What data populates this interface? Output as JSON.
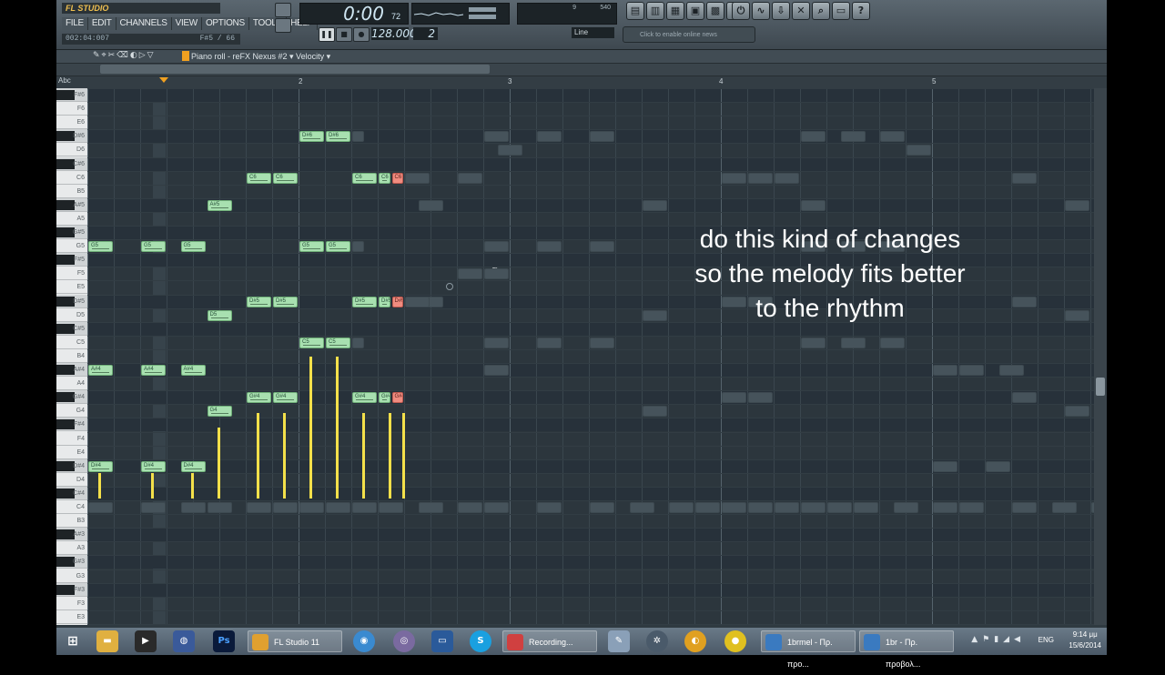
{
  "app": {
    "name": "FL STUDIO"
  },
  "menu": [
    "FILE",
    "EDIT",
    "CHANNELS",
    "VIEW",
    "OPTIONS",
    "TOOLS",
    "HELP"
  ],
  "position_readout": {
    "left": "002:04:007",
    "right": "F#5 / 66"
  },
  "song_time": {
    "main": "0:00",
    "sub": "72"
  },
  "tempo": "128.000",
  "pattern": "2",
  "cpu_readout": {
    "poly": "9",
    "mem": "540"
  },
  "snap": "Line",
  "news": "Click to enable online news",
  "piano_roll": {
    "title": "Piano roll - reFX Nexus #2 ▾  Velocity ▾",
    "abc": "Abc",
    "bars": [
      "2",
      "3",
      "4",
      "5"
    ]
  },
  "keys": [
    "F#6",
    "F6",
    "E6",
    "D#6",
    "D6",
    "C#6",
    "C6",
    "B5",
    "A#5",
    "A5",
    "G#5",
    "G5",
    "F#5",
    "F5",
    "E5",
    "D#5",
    "D5",
    "C#5",
    "C5",
    "B4",
    "A#4",
    "A4",
    "G#4",
    "G4",
    "F#4",
    "F4",
    "E4",
    "D#4",
    "D4",
    "C#4",
    "C4",
    "B3",
    "A#3",
    "A3",
    "G#3",
    "G3",
    "F#3",
    "F3",
    "E3"
  ],
  "notes": [
    {
      "key": "G5",
      "start": 0,
      "len": 1,
      "label": "G5",
      "style": "green"
    },
    {
      "key": "A#4",
      "start": 0,
      "len": 1,
      "label": "A#4",
      "style": "green"
    },
    {
      "key": "D#4",
      "start": 0,
      "len": 1,
      "label": "D#4",
      "style": "green"
    },
    {
      "key": "G5",
      "start": 2,
      "len": 1,
      "label": "G5",
      "style": "green"
    },
    {
      "key": "A#4",
      "start": 2,
      "len": 1,
      "label": "A#4",
      "style": "green"
    },
    {
      "key": "D#4",
      "start": 2,
      "len": 1,
      "label": "D#4",
      "style": "green"
    },
    {
      "key": "G5",
      "start": 3.5,
      "len": 1,
      "label": "G5",
      "style": "green"
    },
    {
      "key": "A#4",
      "start": 3.5,
      "len": 1,
      "label": "A#4",
      "style": "green"
    },
    {
      "key": "D#4",
      "start": 3.5,
      "len": 1,
      "label": "D#4",
      "style": "green"
    },
    {
      "key": "A#5",
      "start": 4.5,
      "len": 1,
      "label": "A#5",
      "style": "green"
    },
    {
      "key": "D5",
      "start": 4.5,
      "len": 1,
      "label": "D5",
      "style": "green"
    },
    {
      "key": "G4",
      "start": 4.5,
      "len": 1,
      "label": "G4",
      "style": "green"
    },
    {
      "key": "C6",
      "start": 6,
      "len": 1,
      "label": "C6",
      "style": "green"
    },
    {
      "key": "D#5",
      "start": 6,
      "len": 1,
      "label": "D#5",
      "style": "green"
    },
    {
      "key": "G#4",
      "start": 6,
      "len": 1,
      "label": "G#4",
      "style": "green"
    },
    {
      "key": "C6",
      "start": 7,
      "len": 1,
      "label": "C6",
      "style": "green"
    },
    {
      "key": "D#5",
      "start": 7,
      "len": 1,
      "label": "D#5",
      "style": "green"
    },
    {
      "key": "G#4",
      "start": 7,
      "len": 1,
      "label": "G#4",
      "style": "green"
    },
    {
      "key": "D#6",
      "start": 8,
      "len": 1,
      "label": "D#6",
      "style": "green"
    },
    {
      "key": "G5",
      "start": 8,
      "len": 1,
      "label": "G5",
      "style": "green"
    },
    {
      "key": "C5",
      "start": 8,
      "len": 1,
      "label": "C5",
      "style": "green"
    },
    {
      "key": "D#6",
      "start": 9,
      "len": 1,
      "label": "D#6",
      "style": "green"
    },
    {
      "key": "G5",
      "start": 9,
      "len": 1,
      "label": "G5",
      "style": "green"
    },
    {
      "key": "C5",
      "start": 9,
      "len": 1,
      "label": "C5",
      "style": "green"
    },
    {
      "key": "C6",
      "start": 10,
      "len": 1,
      "label": "C6",
      "style": "green"
    },
    {
      "key": "D#5",
      "start": 10,
      "len": 1,
      "label": "D#5",
      "style": "green"
    },
    {
      "key": "G#4",
      "start": 10,
      "len": 1,
      "label": "G#4",
      "style": "green"
    },
    {
      "key": "C6",
      "start": 11,
      "len": 0.5,
      "label": "C6",
      "style": "green"
    },
    {
      "key": "D#5",
      "start": 11,
      "len": 0.5,
      "label": "D#5",
      "style": "green"
    },
    {
      "key": "G#4",
      "start": 11,
      "len": 0.5,
      "label": "G#4",
      "style": "green"
    },
    {
      "key": "C6",
      "start": 11.5,
      "len": 0.5,
      "label": "C6",
      "style": "red"
    },
    {
      "key": "D#5",
      "start": 11.5,
      "len": 0.5,
      "label": "D#5",
      "style": "red"
    },
    {
      "key": "G#4",
      "start": 11.5,
      "len": 0.5,
      "label": "G#4",
      "style": "red"
    }
  ],
  "velocities": [
    {
      "start": 0,
      "v": 0.18
    },
    {
      "start": 2,
      "v": 0.18
    },
    {
      "start": 3.5,
      "v": 0.18
    },
    {
      "start": 4.5,
      "v": 0.5
    },
    {
      "start": 6,
      "v": 0.6
    },
    {
      "start": 7,
      "v": 0.6
    },
    {
      "start": 8,
      "v": 1.0
    },
    {
      "start": 9,
      "v": 1.0
    },
    {
      "start": 10,
      "v": 0.6
    },
    {
      "start": 11,
      "v": 0.6
    },
    {
      "start": 11.5,
      "v": 0.6
    }
  ],
  "overlay_text": [
    "do this kind of changes",
    "so the melody fits better",
    "to the rhythm"
  ],
  "taskbar": {
    "apps": [
      {
        "label": "FL Studio 11"
      },
      {
        "label": "Recording..."
      },
      {
        "label": "1brmel - Πρ. προ..."
      },
      {
        "label": "1br - Πρ. προβολ..."
      }
    ],
    "lang": "ENG",
    "time": "9:14 μμ",
    "date": "15/6/2014"
  }
}
